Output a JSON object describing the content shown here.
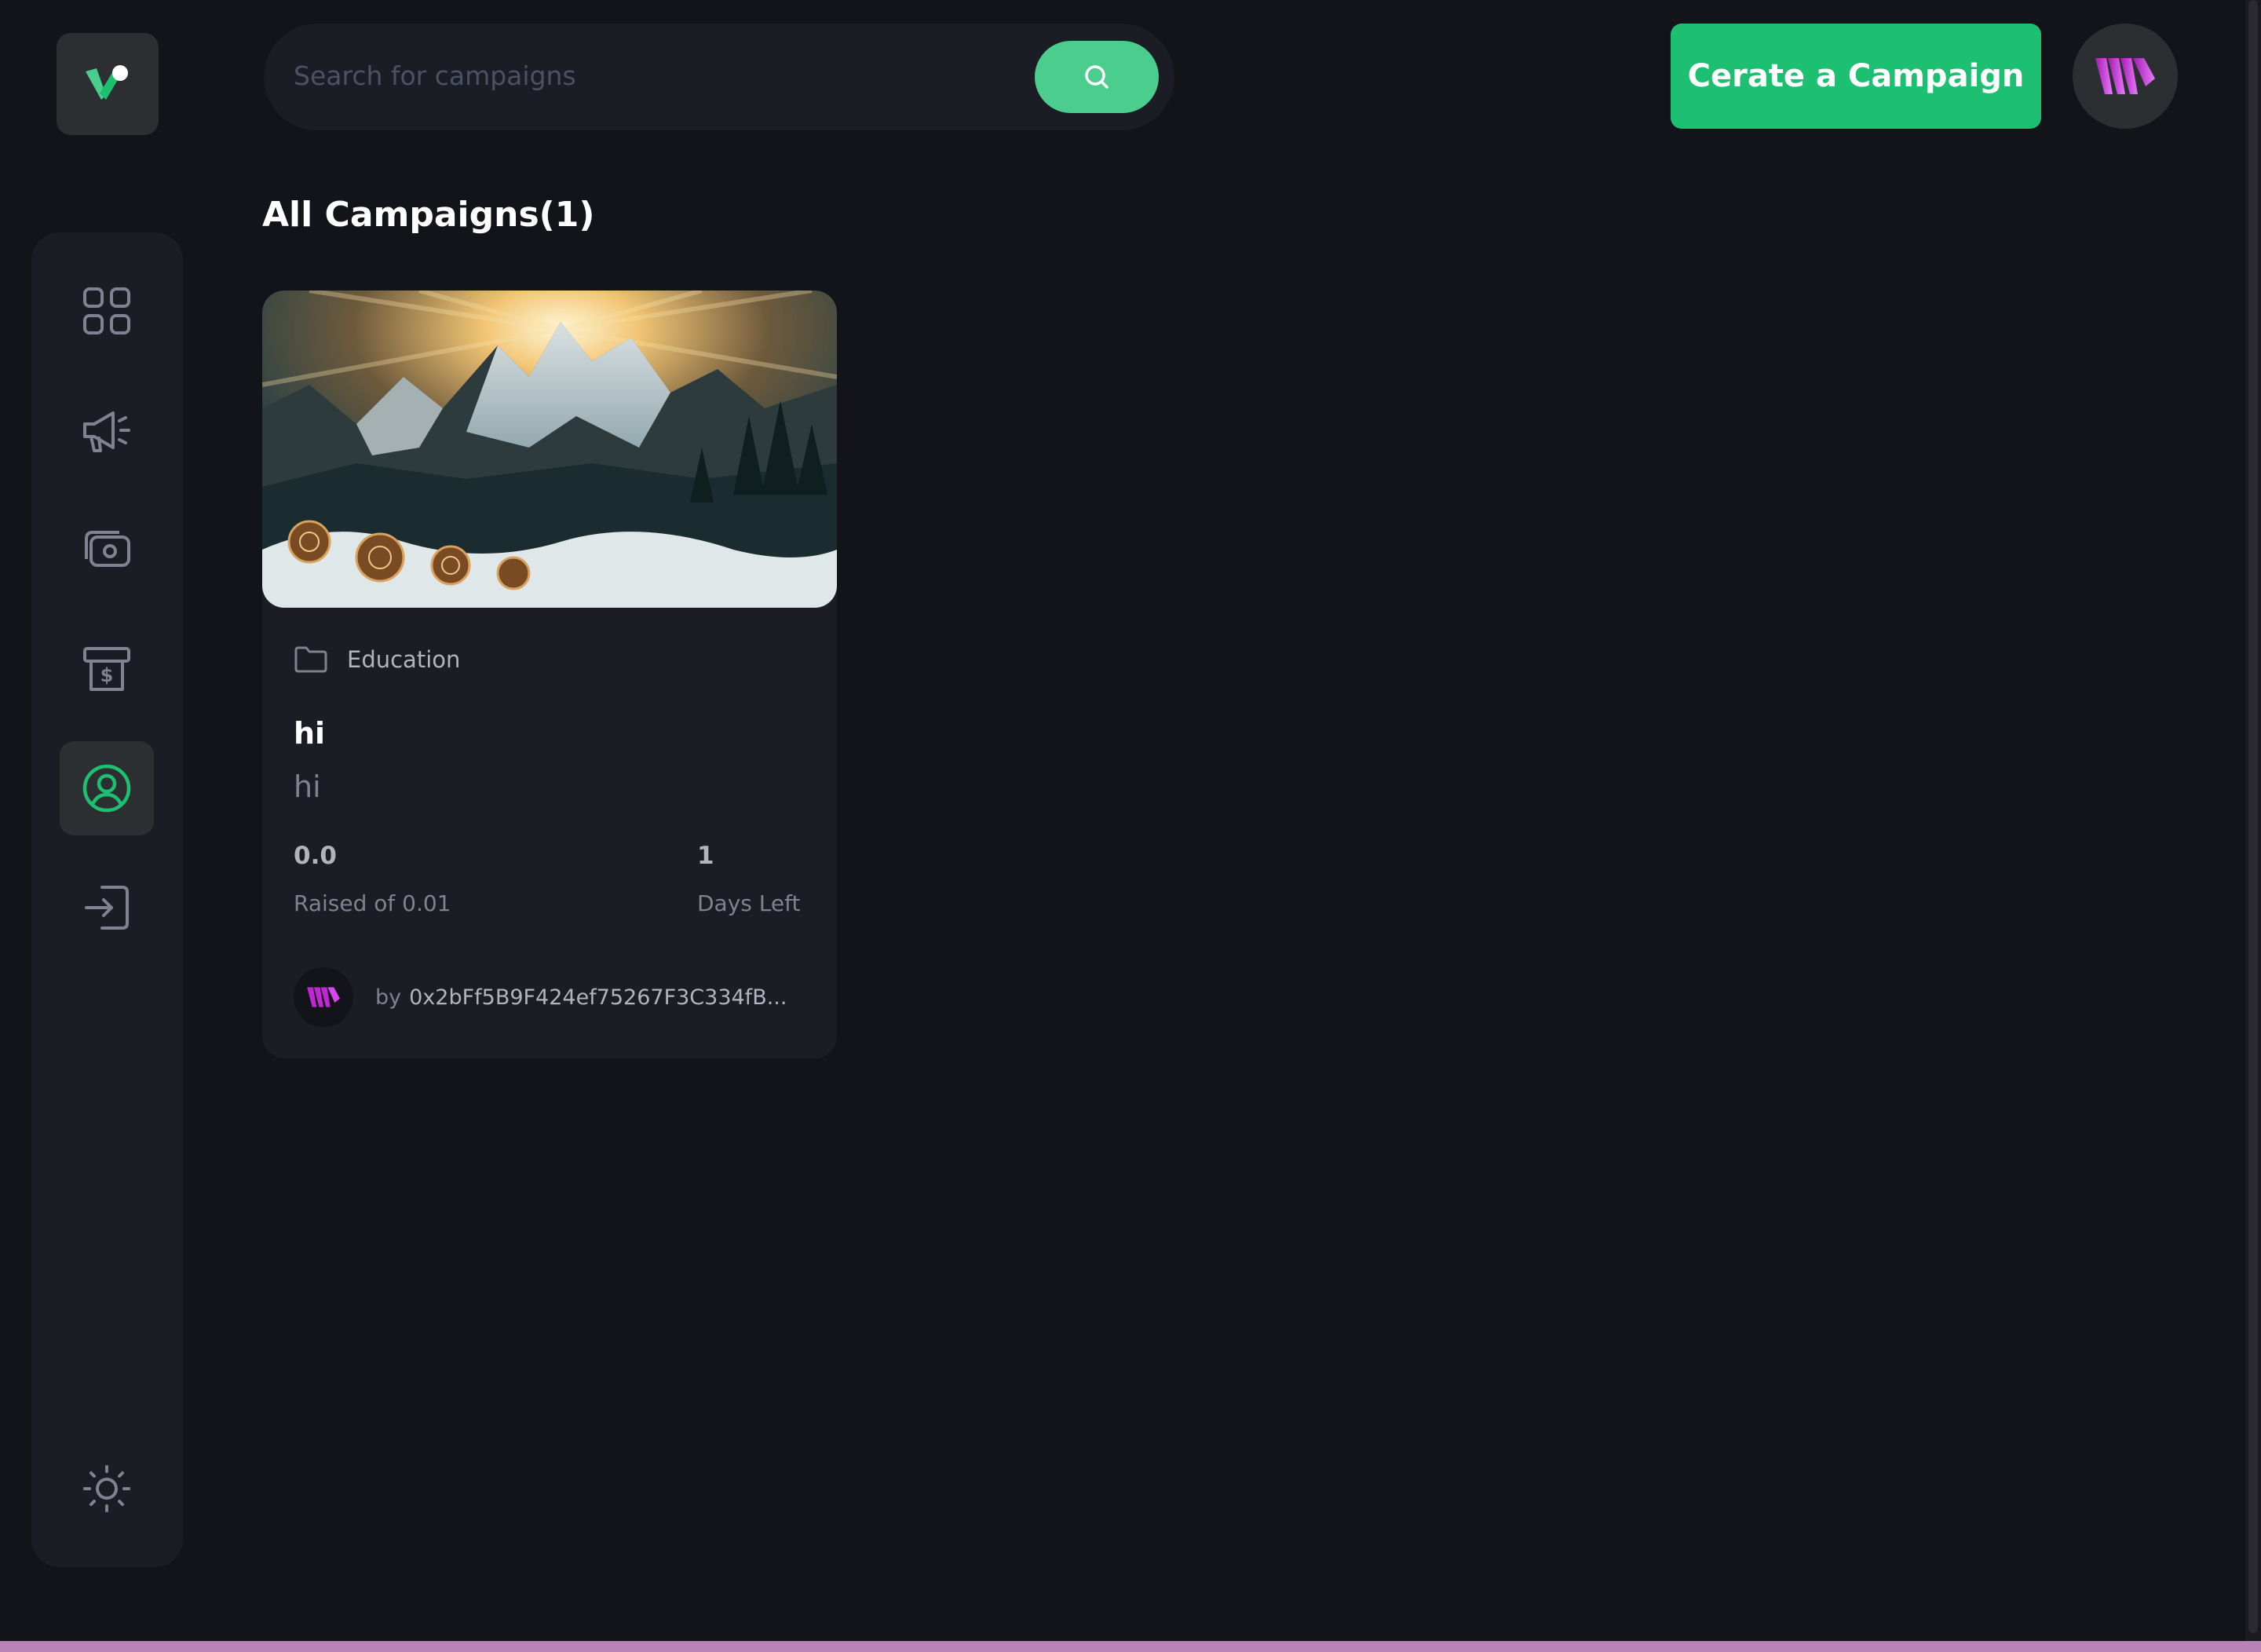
{
  "colors": {
    "background": "#13141a",
    "panel": "#1c1c24",
    "accent": "#1dc071",
    "search_accent": "#4acd8d",
    "muted_text": "#808191",
    "light_text": "#b2b3bd",
    "brand_purple": "#c026d3"
  },
  "logo": {
    "icon": "brand-logo-icon"
  },
  "sidebar": {
    "items": [
      {
        "name": "dashboard",
        "icon": "grid-icon",
        "active": false
      },
      {
        "name": "campaign",
        "icon": "megaphone-icon",
        "active": false
      },
      {
        "name": "payment",
        "icon": "payment-icon",
        "active": false
      },
      {
        "name": "withdraw",
        "icon": "withdraw-icon",
        "active": false
      },
      {
        "name": "profile",
        "icon": "user-circle-icon",
        "active": true
      },
      {
        "name": "logout",
        "icon": "logout-icon",
        "active": false
      }
    ],
    "theme_toggle_icon": "sun-icon"
  },
  "header": {
    "search_placeholder": "Search for campaigns",
    "search_icon": "search-icon",
    "create_button_label": "Cerate a Campaign",
    "avatar_icon": "wallet-avatar-icon"
  },
  "main": {
    "title": "All Campaigns(1)",
    "campaigns": [
      {
        "category": "Education",
        "category_icon": "folder-icon",
        "title": "hi",
        "description": "hi",
        "raised_value": "0.0",
        "raised_label": "Raised of 0.01",
        "days_value": "1",
        "days_label": "Days Left",
        "owner_prefix": "by",
        "owner_address": "0x2bFf5B9F424ef75267F3C334fB..."
      }
    ]
  }
}
